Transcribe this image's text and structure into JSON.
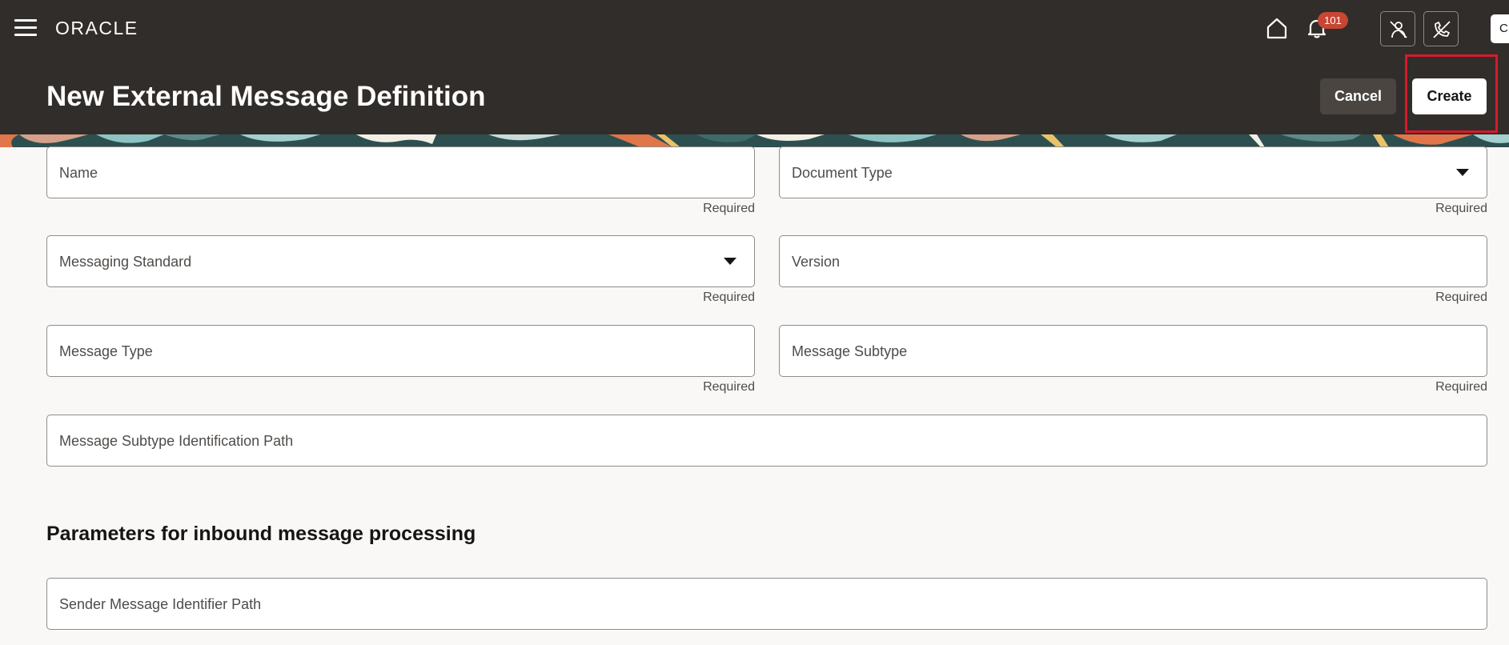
{
  "header": {
    "brand": "ORACLE",
    "notification_count": "101",
    "user_initials": "CI"
  },
  "page": {
    "title": "New External Message Definition",
    "cancel_label": "Cancel",
    "create_label": "Create"
  },
  "form": {
    "name": {
      "label": "Name",
      "hint": "Required"
    },
    "document_type": {
      "label": "Document Type",
      "hint": "Required"
    },
    "messaging_standard": {
      "label": "Messaging Standard",
      "hint": "Required"
    },
    "version": {
      "label": "Version",
      "hint": "Required"
    },
    "message_type": {
      "label": "Message Type",
      "hint": "Required"
    },
    "message_subtype": {
      "label": "Message Subtype",
      "hint": "Required"
    },
    "subtype_path": {
      "label": "Message Subtype Identification Path"
    }
  },
  "inbound": {
    "heading": "Parameters for inbound message processing",
    "sender_path": {
      "label": "Sender Message Identifier Path"
    }
  },
  "colors": {
    "header_bg": "#312d2a",
    "badge": "#c74634",
    "highlight": "#d61a2a"
  }
}
